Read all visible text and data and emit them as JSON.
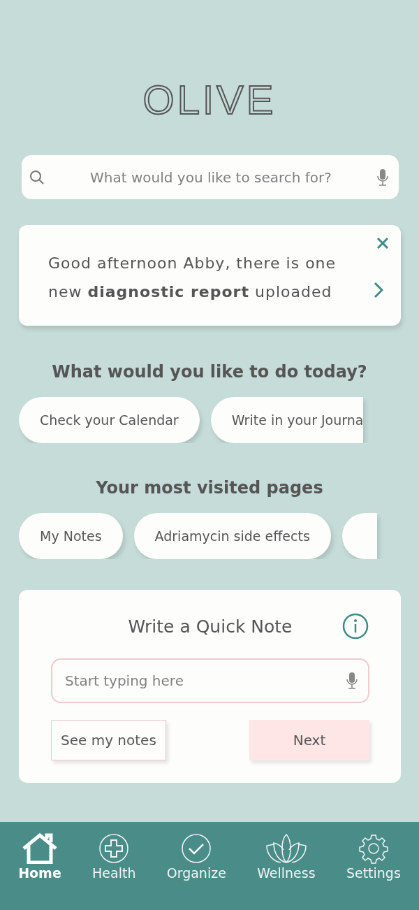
{
  "logo": "OLIVE",
  "search": {
    "placeholder": "What would you like to search for?"
  },
  "notice": {
    "text": "Good afternoon Abby, there is one new **diagnostic report** uploaded"
  },
  "actions": {
    "title": "What would you like to do today?",
    "items": [
      {
        "label": "Check your Calendar"
      },
      {
        "label": "Write in your Journa"
      }
    ]
  },
  "visited": {
    "title": "Your most visited pages",
    "items": [
      {
        "label": "My Notes"
      },
      {
        "kind": "chip",
        "label": "Adriamycin side effects"
      },
      {
        "kind": "cut"
      }
    ]
  },
  "quick_note": {
    "title": "Write a Quick Note",
    "placeholder": "Start typing here",
    "secondary": "See my notes",
    "primary": "Next"
  },
  "nav": [
    {
      "kind": "home",
      "label": "Home",
      "selected": true
    },
    {
      "kind": "health",
      "label": "Health",
      "selected": false
    },
    {
      "kind": "organize",
      "label": "Organize",
      "selected": false
    },
    {
      "kind": "wellness",
      "label": "Wellness",
      "selected": false
    },
    {
      "kind": "settings",
      "label": "Settings",
      "selected": false
    }
  ]
}
